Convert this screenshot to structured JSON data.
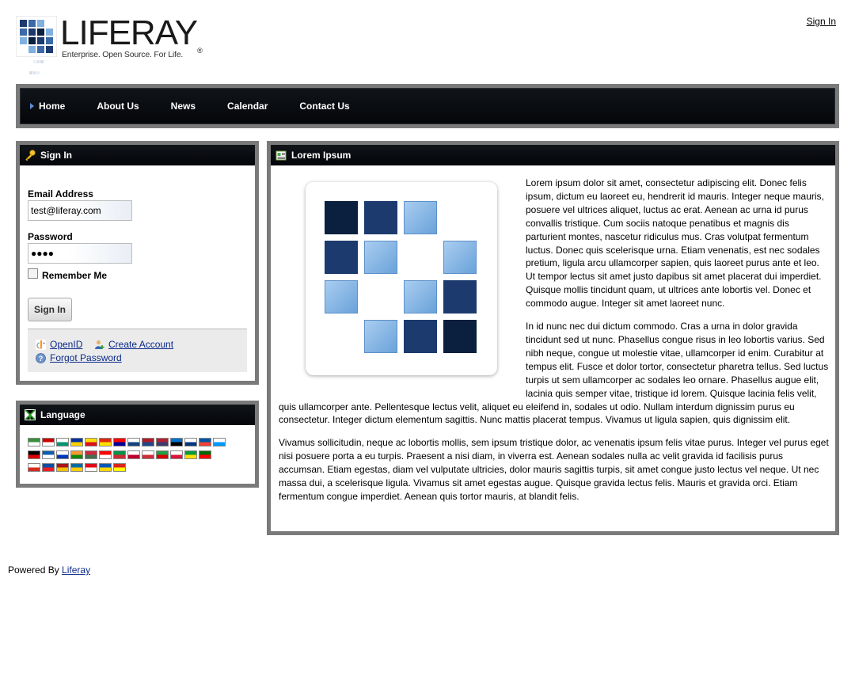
{
  "header": {
    "logo_word": "LIFERAY",
    "logo_reg": "®",
    "logo_tagline": "Enterprise. Open Source. For Life.",
    "sign_in_link": "Sign In"
  },
  "nav": {
    "items": [
      {
        "label": "Home",
        "active": true
      },
      {
        "label": "About Us",
        "active": false
      },
      {
        "label": "News",
        "active": false
      },
      {
        "label": "Calendar",
        "active": false
      },
      {
        "label": "Contact Us",
        "active": false
      }
    ]
  },
  "signin": {
    "title": "Sign In",
    "title_icon": "key-icon",
    "email_label": "Email Address",
    "email_value": "test@liferay.com",
    "password_label": "Password",
    "password_value": "●●●●",
    "remember_label": "Remember Me",
    "submit_label": "Sign In",
    "openid_label": "OpenID",
    "create_account_label": "Create Account",
    "forgot_password_label": "Forgot Password"
  },
  "language": {
    "title": "Language",
    "title_icon": "globe-flag-icon",
    "flags": [
      [
        "#3a8f3a",
        "#ffffff"
      ],
      [
        "#cc0000",
        "#ffffff"
      ],
      [
        "#ffffff",
        "#00966e"
      ],
      [
        "#0033a0",
        "#ffd100"
      ],
      [
        "#fcdd09",
        "#da121a"
      ],
      [
        "#de2910",
        "#ffde00"
      ],
      [
        "#fe0000",
        "#000095"
      ],
      [
        "#ffffff",
        "#11457e"
      ],
      [
        "#ae1c28",
        "#21468b"
      ],
      [
        "#b22234",
        "#3c3b6e"
      ],
      [
        "#0072ce",
        "#000000"
      ],
      [
        "#ffffff",
        "#003580"
      ],
      [
        "#0055a4",
        "#ef4135"
      ],
      [
        "#ffffff",
        "#0099ff"
      ],
      [
        "#000000",
        "#dd0000"
      ],
      [
        "#0d5eaf",
        "#ffffff"
      ],
      [
        "#ffffff",
        "#0038b8"
      ],
      [
        "#ff9933",
        "#138808"
      ],
      [
        "#cd2a3e",
        "#436f4d"
      ],
      [
        "#ff0000",
        "#ffffff"
      ],
      [
        "#009246",
        "#ce2b37"
      ],
      [
        "#ffffff",
        "#bc002d"
      ],
      [
        "#ffffff",
        "#cd2e3a"
      ],
      [
        "#239f40",
        "#da0000"
      ],
      [
        "#ffffff",
        "#dc143c"
      ],
      [
        "#009c3b",
        "#ffdf00"
      ],
      [
        "#006600",
        "#ff0000"
      ],
      [
        "#ffffff",
        "#d52b1e"
      ],
      [
        "#0b4ea2",
        "#ee1c25"
      ],
      [
        "#aa151b",
        "#f1bf00"
      ],
      [
        "#006aa7",
        "#fecc00"
      ],
      [
        "#e30a17",
        "#ffffff"
      ],
      [
        "#0057b7",
        "#ffd700"
      ],
      [
        "#da251d",
        "#ffff00"
      ]
    ]
  },
  "content": {
    "title": "Lorem Ipsum",
    "title_icon": "article-icon",
    "paragraphs": [
      "Lorem ipsum dolor sit amet, consectetur adipiscing elit. Donec felis ipsum, dictum eu laoreet eu, hendrerit id mauris. Integer neque mauris, posuere vel ultrices aliquet, luctus ac erat. Aenean ac urna id purus convallis tristique. Cum sociis natoque penatibus et magnis dis parturient montes, nascetur ridiculus mus. Cras volutpat fermentum luctus. Donec quis scelerisque urna. Etiam venenatis, est nec sodales pretium, ligula arcu ullamcorper sapien, quis laoreet purus ante et leo. Ut tempor lectus sit amet justo dapibus sit amet placerat dui imperdiet. Quisque mollis tincidunt quam, ut ultrices ante lobortis vel. Donec et commodo augue. Integer sit amet laoreet nunc.",
      "In id nunc nec dui dictum commodo. Cras a urna in dolor gravida tincidunt sed ut nunc. Phasellus congue risus in leo lobortis varius. Sed nibh neque, congue ut molestie vitae, ullamcorper id enim. Curabitur at tempus elit. Fusce et dolor tortor, consectetur pharetra tellus. Sed luctus turpis ut sem ullamcorper ac sodales leo ornare. Phasellus augue elit, lacinia quis semper vitae, tristique id lorem. Quisque lacinia felis velit, quis ullamcorper ante. Pellentesque lectus velit, aliquet eu eleifend in, sodales ut odio. Nullam interdum dignissim purus eu consectetur. Integer dictum elementum sagittis. Nunc mattis placerat tempus. Vivamus ut ligula sapien, quis dignissim elit.",
      "Vivamus sollicitudin, neque ac lobortis mollis, sem ipsum tristique dolor, ac venenatis ipsum felis vitae purus. Integer vel purus eget nisi posuere porta a eu turpis. Praesent a nisi diam, in viverra est. Aenean sodales nulla ac velit gravida id facilisis purus accumsan. Etiam egestas, diam vel vulputate ultricies, dolor mauris sagittis turpis, sit amet congue justo lectus vel neque. Ut nec massa dui, a scelerisque ligula. Vivamus sit amet egestas augue. Quisque gravida lectus felis. Mauris et gravida orci. Etiam fermentum congue imperdiet. Aenean quis tortor mauris, at blandit felis."
    ]
  },
  "footer": {
    "powered_by": "Powered By",
    "powered_link": "Liferay"
  },
  "colors": {
    "dark_navy": "#0b1f3f",
    "navy": "#1c3a6e",
    "light_blue": "#7fb0e0",
    "frame_gray": "#7a7a7a",
    "nav_black": "#05070b",
    "link_blue": "#0b2a8a"
  }
}
